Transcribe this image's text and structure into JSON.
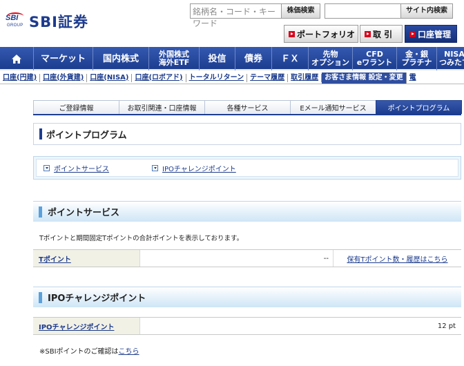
{
  "header": {
    "logo_text": "SBI証券",
    "logo_mark": "SBI",
    "logo_group": "GROUP",
    "stock_search_placeholder": "銘柄名・コード・キーワード",
    "stock_search_button": "株価検索",
    "site_search_placeholder": "",
    "site_search_button": "サイト内検索",
    "portfolio_button": "ポートフォリオ",
    "trade_button": "取 引",
    "account_button": "口座管理"
  },
  "main_nav": {
    "home_icon": "home-icon",
    "items": [
      {
        "line1": "マーケット",
        "line2": ""
      },
      {
        "line1": "国内株式",
        "line2": ""
      },
      {
        "line1": "外国株式",
        "line2": "海外ETF"
      },
      {
        "line1": "投信",
        "line2": ""
      },
      {
        "line1": "債券",
        "line2": ""
      },
      {
        "line1": "ＦＸ",
        "line2": ""
      },
      {
        "line1": "先物",
        "line2": "オプション"
      },
      {
        "line1": "CFD",
        "line2": "eワラント"
      },
      {
        "line1": "金・銀",
        "line2": "プラチナ"
      },
      {
        "line1": "NISA",
        "line2": "つみたて"
      }
    ]
  },
  "sub_nav": {
    "items": [
      "口座(円建)",
      "口座(外貨建)",
      "口座(NISA)",
      "口座(ロボアド)",
      "トータルリターン",
      "テーマ履歴",
      "取引履歴",
      "お客さま情報 設定・変更",
      "電"
    ],
    "active_index": 7
  },
  "settings_tabs": {
    "items": [
      "ご登録情報",
      "お取引関連・口座情報",
      "各種サービス",
      "Eメール通知サービス",
      "ポイントプログラム"
    ],
    "active_index": 4
  },
  "page": {
    "title": "ポイントプログラム",
    "anchor_links": [
      "ポイントサービス",
      "IPOチャレンジポイント"
    ]
  },
  "point_service": {
    "heading": "ポイントサービス",
    "description": "Tポイントと期間固定Tポイントの合計ポイントを表示しております。",
    "row_label": "Tポイント",
    "row_value": "--",
    "row_link": "保有Tポイント数・履歴はこちら"
  },
  "ipo_point": {
    "heading": "IPOチャレンジポイント",
    "row_label": "IPOチャレンジポイント",
    "row_value": "12 pt"
  },
  "footnote": {
    "prefix": "※SBIポイントのご確認は",
    "link": "こちら"
  },
  "colors": {
    "brand_blue": "#1c3d8f",
    "accent_red": "#d7001b",
    "section_blue": "#5aa0dc"
  }
}
